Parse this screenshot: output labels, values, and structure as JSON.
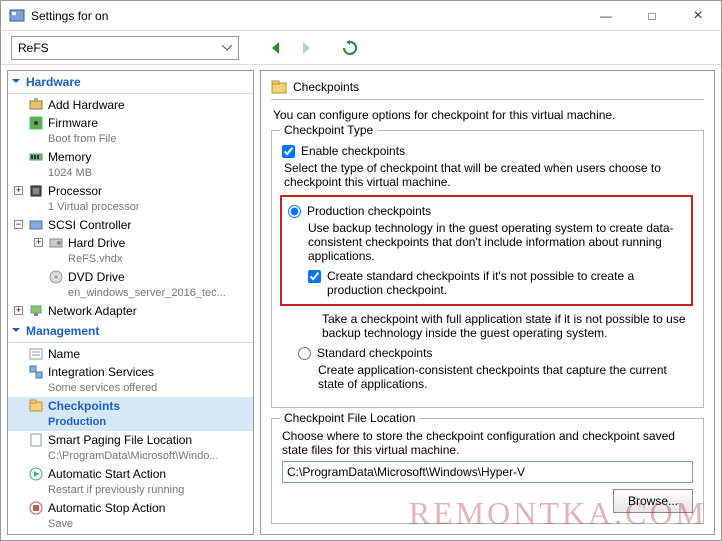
{
  "window": {
    "title": "Settings for        on",
    "minimize": "—",
    "maximize": "□",
    "close": "×"
  },
  "toolbar": {
    "vm_name": "ReFS"
  },
  "sidebar": {
    "hardware": {
      "header": "Hardware",
      "add_hardware": "Add Hardware",
      "firmware": "Firmware",
      "firmware_sub": "Boot from File",
      "memory": "Memory",
      "memory_sub": "1024 MB",
      "processor": "Processor",
      "processor_sub": "1 Virtual processor",
      "scsi": "SCSI Controller",
      "hard_drive": "Hard Drive",
      "hard_drive_sub": "ReFS.vhdx",
      "dvd_drive": "DVD Drive",
      "dvd_drive_sub": "en_windows_server_2016_tec...",
      "network": "Network Adapter"
    },
    "management": {
      "header": "Management",
      "name": "Name",
      "integration": "Integration Services",
      "integration_sub": "Some services offered",
      "checkpoints": "Checkpoints",
      "checkpoints_sub": "Production",
      "smart_paging": "Smart Paging File Location",
      "smart_paging_sub": "C:\\ProgramData\\Microsoft\\Windo...",
      "auto_start": "Automatic Start Action",
      "auto_start_sub": "Restart if previously running",
      "auto_stop": "Automatic Stop Action",
      "auto_stop_sub": "Save"
    }
  },
  "content": {
    "title": "Checkpoints",
    "intro": "You can configure options for checkpoint for this virtual machine.",
    "type_legend": "Checkpoint Type",
    "enable_label": "Enable checkpoints",
    "type_help": "Select the type of checkpoint that will be created when users choose to checkpoint this virtual machine.",
    "prod_label": "Production checkpoints",
    "prod_help": "Use backup technology in the guest operating system to create data-consistent checkpoints that don't include information about running applications.",
    "create_std_label": "Create standard checkpoints if it's not possible to create a production checkpoint.",
    "prod_below": "Take a checkpoint with full application state if it is not possible to use backup technology inside the guest operating system.",
    "std_label": "Standard checkpoints",
    "std_help": "Create application-consistent checkpoints that capture the current state of applications.",
    "loc_legend": "Checkpoint File Location",
    "loc_help": "Choose where to store the checkpoint configuration and checkpoint saved state files for this virtual machine.",
    "loc_path": "C:\\ProgramData\\Microsoft\\Windows\\Hyper-V",
    "browse": "Browse..."
  },
  "watermark": "REMONTKA.COM"
}
